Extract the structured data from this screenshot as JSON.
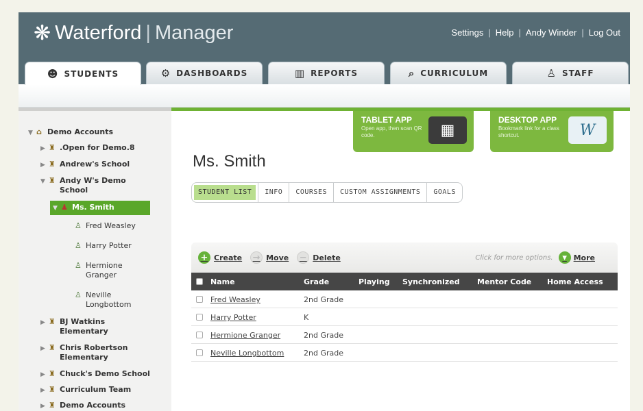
{
  "app": {
    "brand": "Waterford",
    "product": "Manager",
    "top_links": [
      "Settings",
      "Help",
      "Andy Winder",
      "Log Out"
    ]
  },
  "tabs": [
    {
      "label": "STUDENTS",
      "icon": "student-icon",
      "active": true
    },
    {
      "label": "DASHBOARDS",
      "icon": "dashboard-icon",
      "active": false
    },
    {
      "label": "REPORTS",
      "icon": "bar-chart-icon",
      "active": false
    },
    {
      "label": "CURRICULUM",
      "icon": "magnifier-icon",
      "active": false
    },
    {
      "label": "STAFF",
      "icon": "staff-icon",
      "active": false
    }
  ],
  "tree": {
    "root": "Demo Accounts",
    "items": [
      {
        "label": ".Open for Demo.8"
      },
      {
        "label": "Andrew's School"
      },
      {
        "label": "Andy W's Demo School"
      },
      {
        "label": "Ms. Smith"
      },
      {
        "label": "Fred Weasley"
      },
      {
        "label": "Harry Potter"
      },
      {
        "label": "Hermione Granger"
      },
      {
        "label": "Neville Longbottom"
      },
      {
        "label": "BJ Watkins Elementary"
      },
      {
        "label": "Chris Robertson Elementary"
      },
      {
        "label": "Chuck's Demo School"
      },
      {
        "label": "Curriculum Team"
      },
      {
        "label": "Demo Accounts"
      }
    ]
  },
  "promos": [
    {
      "title": "TABLET APP",
      "desc": "Open app, then scan QR code."
    },
    {
      "title": "DESKTOP APP",
      "desc": "Bookmark link for a class shortcut."
    }
  ],
  "page_title": "Ms. Smith",
  "subtabs": [
    {
      "label": "STUDENT LIST",
      "active": true
    },
    {
      "label": "INFO",
      "active": false
    },
    {
      "label": "COURSES",
      "active": false
    },
    {
      "label": "CUSTOM ASSIGNMENTS",
      "active": false
    },
    {
      "label": "GOALS",
      "active": false
    }
  ],
  "toolbar": {
    "create": "Create",
    "move": "Move",
    "delete": "Delete",
    "hint": "Click for more options.",
    "more": "More"
  },
  "table": {
    "headers": [
      "Name",
      "Grade",
      "Playing",
      "Synchronized",
      "Mentor Code",
      "Home Access"
    ],
    "rows": [
      {
        "name": "Fred Weasley",
        "grade": "2nd Grade"
      },
      {
        "name": "Harry Potter",
        "grade": "K"
      },
      {
        "name": "Hermione Granger",
        "grade": "2nd Grade"
      },
      {
        "name": "Neville Longbottom",
        "grade": "2nd Grade"
      }
    ]
  }
}
